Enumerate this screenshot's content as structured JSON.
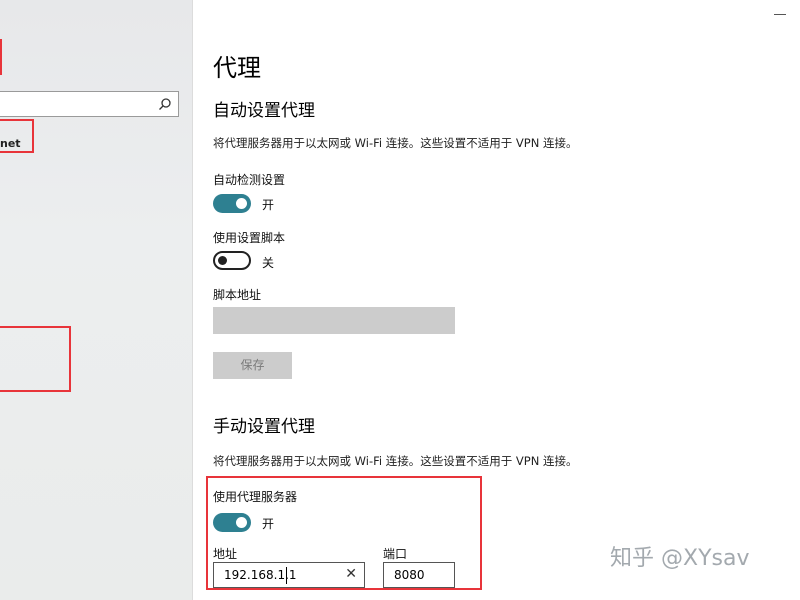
{
  "sidebar": {
    "partial_item": "net"
  },
  "page": {
    "title": "代理"
  },
  "auto_proxy": {
    "section_title": "自动设置代理",
    "description": "将代理服务器用于以太网或 Wi-Fi 连接。这些设置不适用于 VPN 连接。",
    "detect_label": "自动检测设置",
    "detect_state": "开",
    "script_label": "使用设置脚本",
    "script_state": "关",
    "address_label": "脚本地址",
    "save_label": "保存"
  },
  "manual_proxy": {
    "section_title": "手动设置代理",
    "description": "将代理服务器用于以太网或 Wi-Fi 连接。这些设置不适用于 VPN 连接。",
    "use_label": "使用代理服务器",
    "use_state": "开",
    "address_label": "地址",
    "address_value": "192.168.1.1",
    "port_label": "端口",
    "port_value": "8080"
  },
  "watermark": "知乎 @XYsav",
  "colors": {
    "toggle_on": "#2e8091",
    "highlight_red": "#e8343a",
    "disabled_gray": "#cccccc"
  }
}
